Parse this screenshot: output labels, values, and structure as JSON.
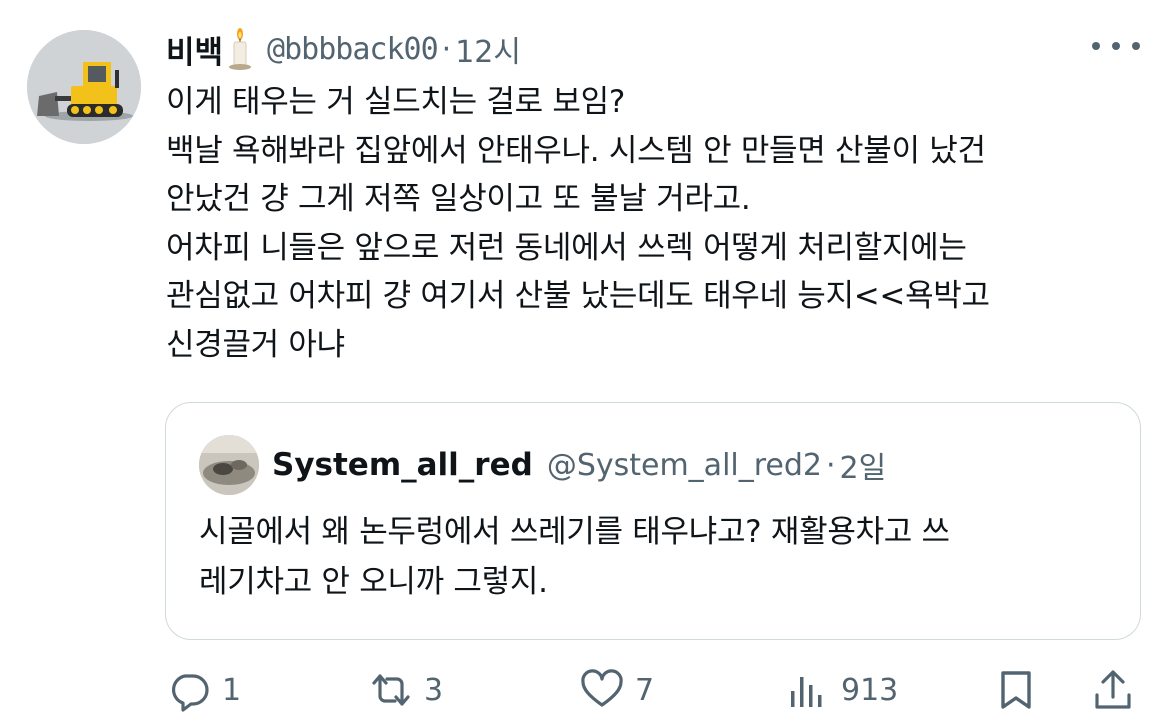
{
  "tweet": {
    "author_name": "비백",
    "author_handle": "@bbbback00",
    "separator": "·",
    "time": "12시",
    "text_lines": [
      "이게 태우는 거 실드치는 걸로 보임?",
      "백날 욕해봐라 집앞에서 안태우나. 시스템 안 만들면 산불이 났건",
      "안났건 걍 그게 저쪽 일상이고 또 불날 거라고.",
      "어차피 니들은 앞으로 저런 동네에서 쓰렉 어떻게 처리할지에는",
      "관심없고 어차피 걍 여기서 산불 났는데도 태우네 능지<<욕박고",
      "신경끌거 아냐"
    ]
  },
  "quoted": {
    "author_name": "System_all_red",
    "author_handle": "@System_all_red2",
    "separator": "·",
    "time": "2일",
    "text_lines": [
      "시골에서 왜 논두렁에서 쓰레기를 태우냐고? 재활용차고 쓰",
      "레기차고 안 오니까 그렇지."
    ]
  },
  "actions": {
    "reply_count": "1",
    "retweet_count": "3",
    "like_count": "7",
    "views_count": "913"
  },
  "icons": {
    "more": "more-horizontal-icon",
    "candle": "candle-emoji-icon",
    "reply": "reply-icon",
    "retweet": "retweet-icon",
    "like": "heart-icon",
    "views": "views-chart-icon",
    "bookmark": "bookmark-icon",
    "share": "share-icon"
  },
  "colors": {
    "text_primary": "#0f1419",
    "text_secondary": "#536471",
    "border": "#cfd9de"
  }
}
